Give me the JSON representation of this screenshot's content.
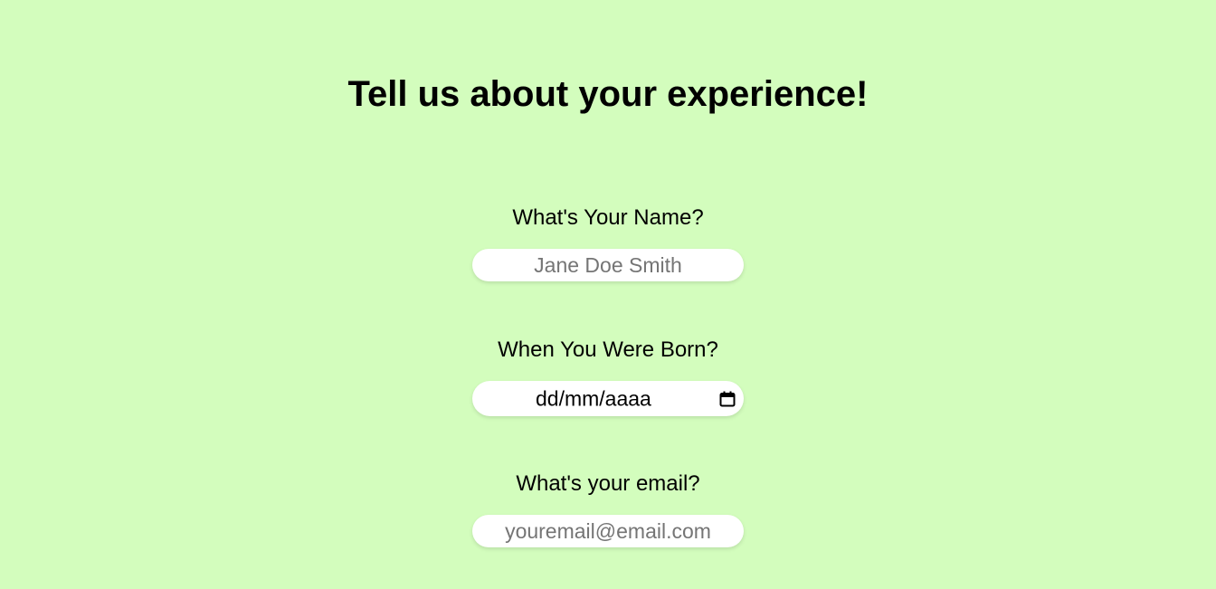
{
  "page": {
    "title": "Tell us about your experience!",
    "background_color": "#d3fdbd"
  },
  "form": {
    "name": {
      "label": "What's Your Name?",
      "placeholder": "Jane Doe Smith",
      "value": ""
    },
    "birth": {
      "label": "When You Were Born?",
      "placeholder": "dd/mm/aaaa",
      "icon": "calendar-icon"
    },
    "email": {
      "label": "What's your email?",
      "placeholder": "youremail@email.com",
      "value": ""
    }
  }
}
